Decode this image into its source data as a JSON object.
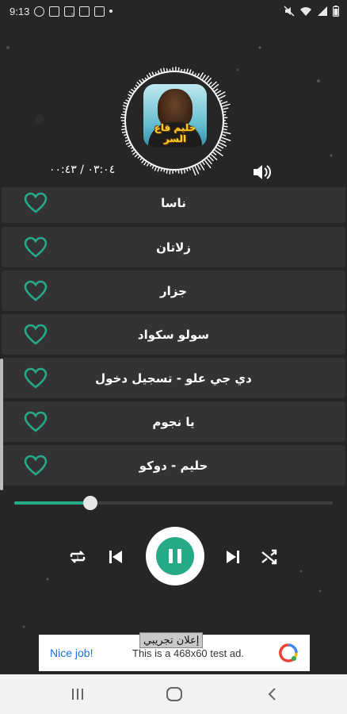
{
  "status_bar": {
    "time": "9:13",
    "left_icons": [
      "circle-status-icon",
      "gallery-icon",
      "image-icon",
      "gallery-icon",
      "image-icon",
      "dot-icon"
    ],
    "right_icons": [
      "mute-icon",
      "wifi-icon",
      "signal-icon",
      "battery-icon"
    ]
  },
  "now_playing": {
    "album_art_caption": "حليم قاع السر",
    "elapsed_total": "٠٣:٠٤ / ٠٠:٤٣"
  },
  "playlist": {
    "tracks": [
      {
        "title": "ناسا"
      },
      {
        "title": "زلاتان"
      },
      {
        "title": "جزار"
      },
      {
        "title": "سولو سكواد"
      },
      {
        "title": "دي جي علو - تسجيل دخول"
      },
      {
        "title": "يا نجوم"
      },
      {
        "title": "حليم - دوكو"
      }
    ]
  },
  "seek": {
    "progress": 0.24
  },
  "controls": [
    "repeat-icon",
    "previous-icon",
    "pause-icon",
    "next-icon",
    "shuffle-icon"
  ],
  "ad": {
    "label": "إعلان تجريبي",
    "left_text": "Nice job!",
    "right_text": "This is a 468x60 test ad."
  },
  "colors": {
    "background": "#262626",
    "row": "#333333",
    "accent": "#26a987"
  }
}
